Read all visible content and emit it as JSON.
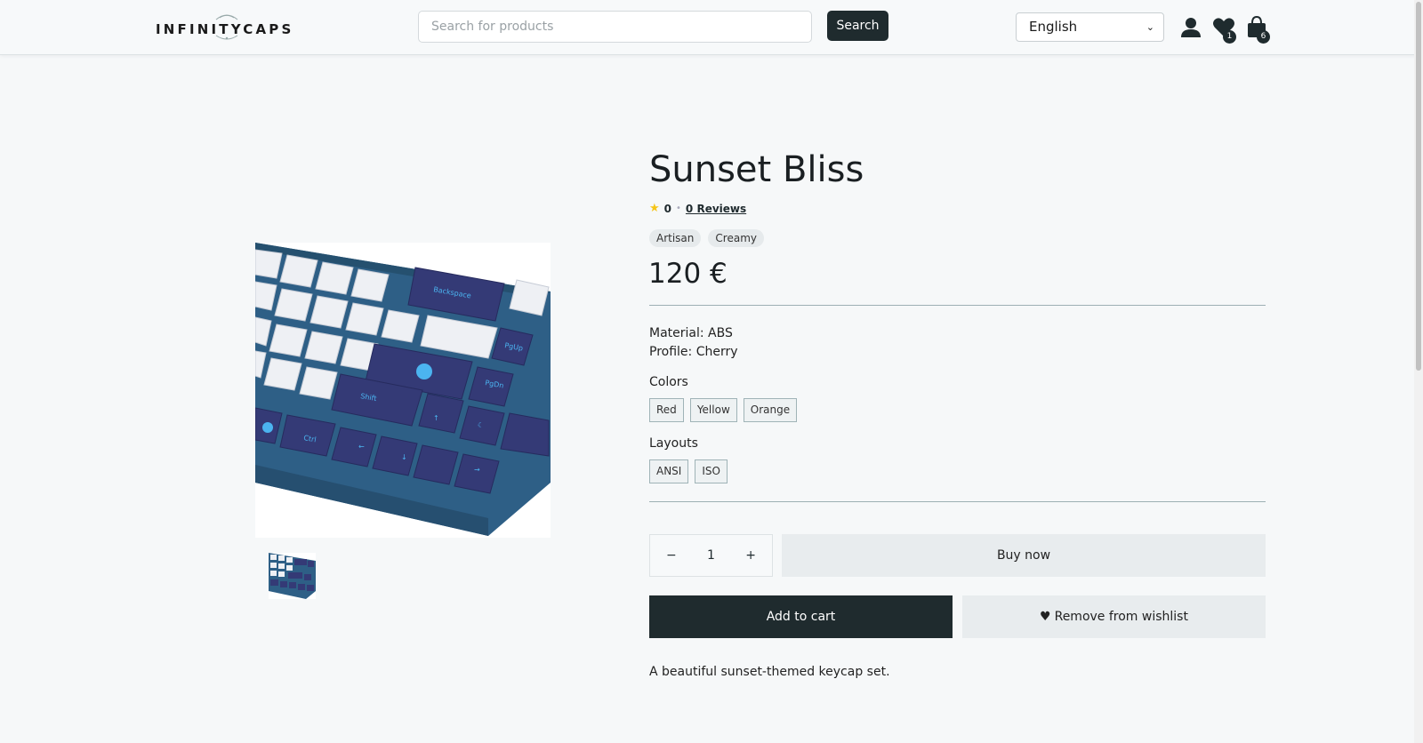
{
  "header": {
    "logo_text": "INFINITYCAPS",
    "search_placeholder": "Search for products",
    "search_button": "Search",
    "language": "English",
    "wishlist_count": "1",
    "cart_count": "6",
    "icons": [
      "user-icon",
      "heart-icon",
      "shopping-bag-icon"
    ]
  },
  "product": {
    "title": "Sunset Bliss",
    "rating": "0",
    "reviews_link": "0 Reviews",
    "tags": [
      "Artisan",
      "Creamy"
    ],
    "price": "120 €",
    "material": "Material: ABS",
    "profile": "Profile: Cherry",
    "colors_label": "Colors",
    "colors": [
      "Red",
      "Yellow",
      "Orange"
    ],
    "layouts_label": "Layouts",
    "layouts": [
      "ANSI",
      "ISO"
    ],
    "quantity": "1",
    "qty_minus": "−",
    "qty_plus": "+",
    "buy_now": "Buy now",
    "add_to_cart": "Add to cart",
    "remove_wishlist": "Remove from wishlist",
    "description": "A beautiful sunset-themed keycap set."
  },
  "colors": {
    "dark": "#1f2b2e",
    "keycap_navy": "#343a76",
    "keycap_white": "#eef0f4",
    "legend_blue": "#4bb4f0",
    "case_blue": "#2e5f86",
    "star": "#f5c518"
  }
}
